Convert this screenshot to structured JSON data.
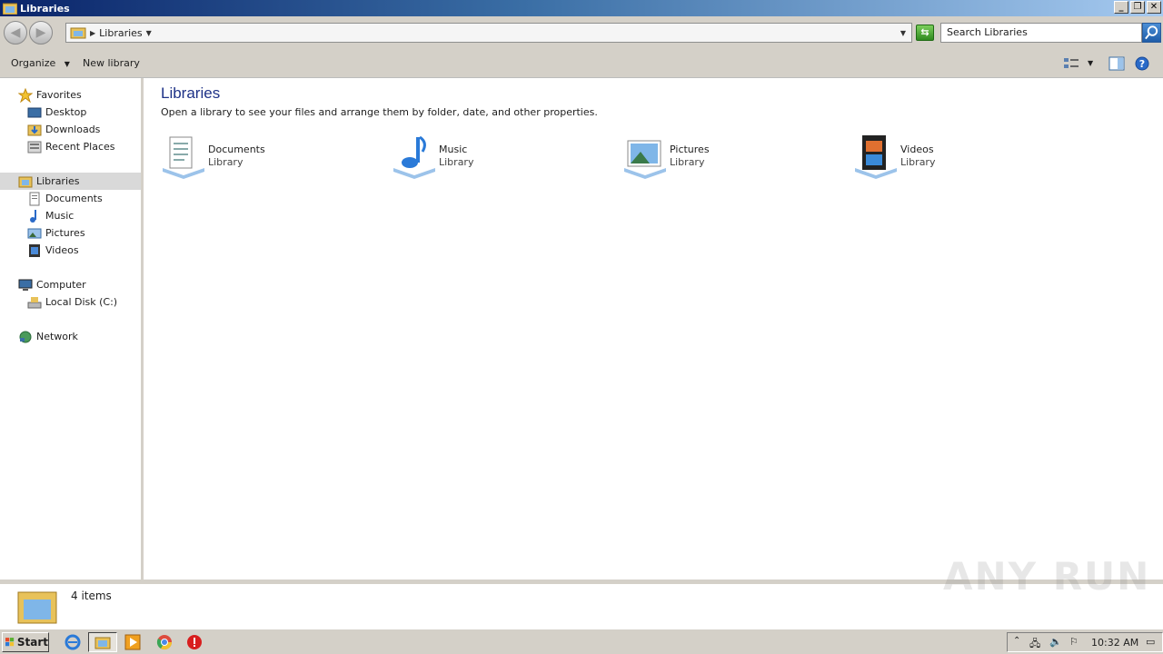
{
  "window": {
    "title": "Libraries",
    "icon": "libraries-folder-icon",
    "controls": [
      "minimize-icon",
      "restore-icon",
      "close-icon"
    ]
  },
  "address": {
    "crumbs": [
      "Libraries"
    ],
    "search_placeholder": "Search Libraries"
  },
  "toolbar": {
    "organize_label": "Organize",
    "new_library_label": "New library"
  },
  "sidebar": {
    "favorites": {
      "label": "Favorites",
      "items": [
        "Desktop",
        "Downloads",
        "Recent Places"
      ]
    },
    "libraries": {
      "label": "Libraries",
      "items": [
        "Documents",
        "Music",
        "Pictures",
        "Videos"
      ]
    },
    "computer": {
      "label": "Computer",
      "items": [
        "Local Disk (C:)"
      ]
    },
    "network": {
      "label": "Network"
    }
  },
  "main": {
    "heading": "Libraries",
    "description": "Open a library to see your files and arrange them by folder, date, and other properties.",
    "libraries": [
      {
        "name": "Documents",
        "type": "Library",
        "icon": "documents-library-icon"
      },
      {
        "name": "Music",
        "type": "Library",
        "icon": "music-library-icon"
      },
      {
        "name": "Pictures",
        "type": "Library",
        "icon": "pictures-library-icon"
      },
      {
        "name": "Videos",
        "type": "Library",
        "icon": "videos-library-icon"
      }
    ]
  },
  "status": {
    "item_count": "4 items"
  },
  "watermark": "ANY RUN",
  "taskbar": {
    "start_label": "Start",
    "clock": "10:32 AM"
  },
  "colors": {
    "title_gradient_start": "#0a246a",
    "heading_blue": "#1e3287",
    "chrome_gray": "#d4d0c8",
    "selection_gray": "#d9d9d9"
  }
}
